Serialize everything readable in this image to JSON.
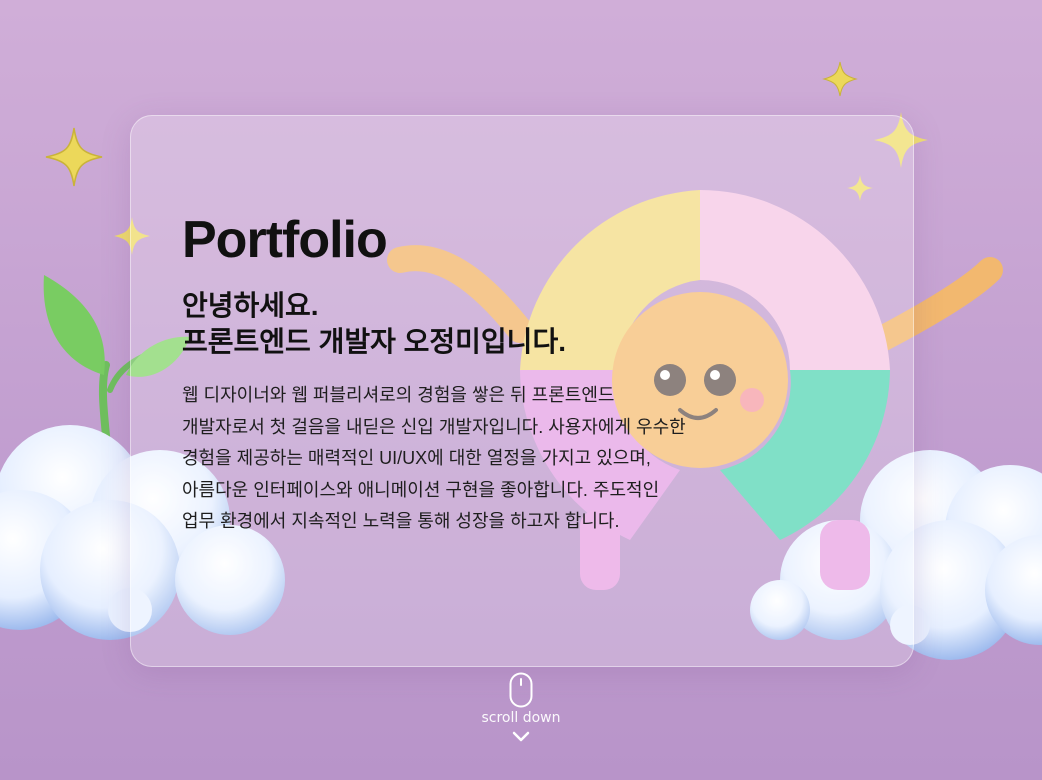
{
  "hero": {
    "title": "Portfolio",
    "greeting_line1": "안녕하세요.",
    "greeting_line2": "프론트엔드 개발자 오정미입니다.",
    "description_lines": [
      "웹 디자이너와 웹 퍼블리셔로의 경험을 쌓은 뒤 프론트엔드",
      "개발자로서 첫 걸음을 내딛은 신입 개발자입니다. 사용자에게 우수한",
      "경험을 제공하는 매력적인 UI/UX에 대한 열정을 가지고 있으며,",
      "아름다운 인터페이스와 애니메이션 구현을 좋아합니다. 주도적인",
      "업무 환경에서 지속적인 노력을 통해 성장을 하고자 합니다."
    ]
  },
  "scroll": {
    "label": "scroll down",
    "mouse_icon": "mouse-icon",
    "arrow_icon": "chevron-down-icon"
  },
  "colors": {
    "background": "#c9a6d4",
    "card": "rgba(255,255,255,0.22)",
    "text": "#111111",
    "sparkle": "#f2df6a"
  }
}
